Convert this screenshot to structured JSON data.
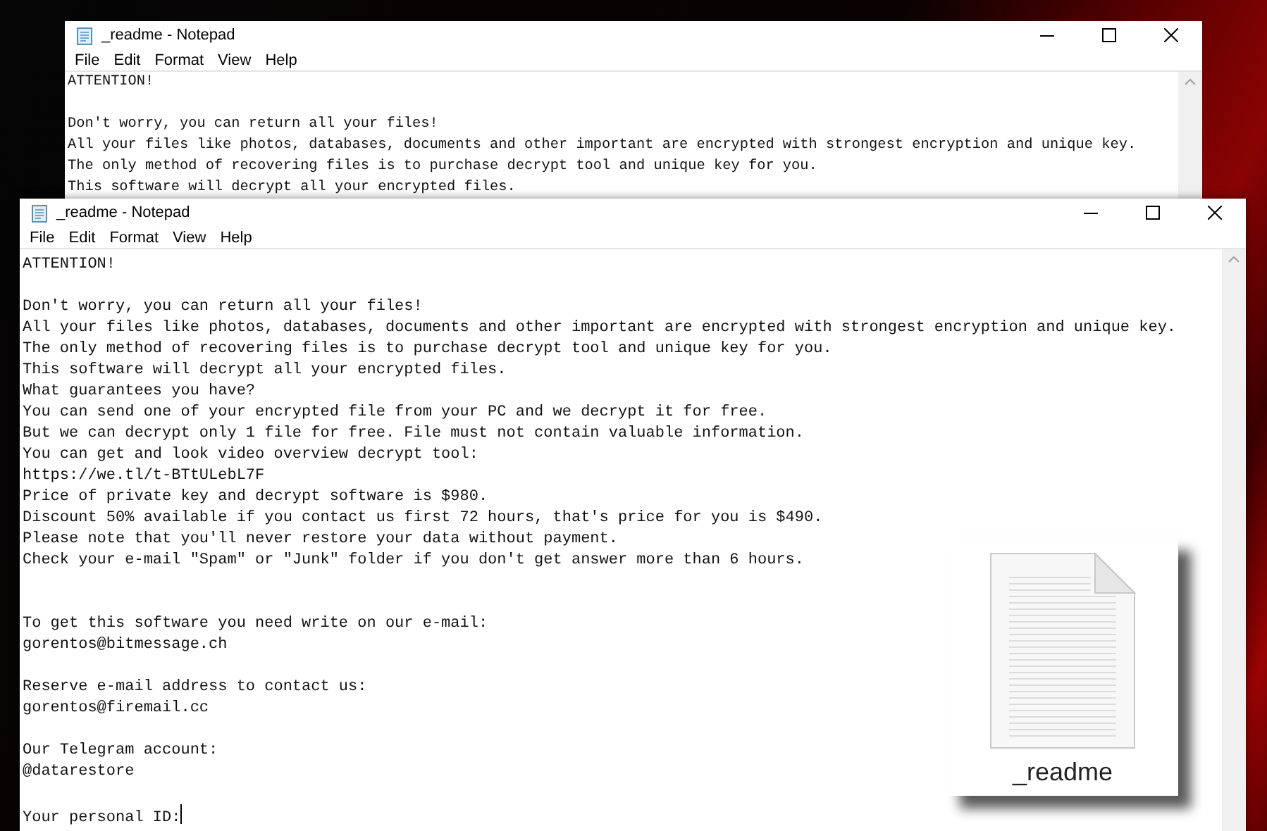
{
  "windows": [
    {
      "title": "_readme - Notepad",
      "active": false,
      "menu": [
        "File",
        "Edit",
        "Format",
        "View",
        "Help"
      ],
      "lines": [
        {
          "kind": "text",
          "text": "ATTENTION!"
        },
        {
          "kind": "blank"
        },
        {
          "kind": "text",
          "text": "Don't worry, you can return all your files!"
        },
        {
          "kind": "text",
          "text": "All your files like photos, databases, documents and other important are encrypted with strongest encryption and unique key."
        },
        {
          "kind": "text",
          "text": "The only method of recovering files is to purchase decrypt tool and unique key for you."
        },
        {
          "kind": "text",
          "text": "This software will decrypt all your encrypted files."
        }
      ]
    },
    {
      "title": "_readme - Notepad",
      "active": true,
      "menu": [
        "File",
        "Edit",
        "Format",
        "View",
        "Help"
      ],
      "lines": [
        {
          "kind": "text",
          "text": "ATTENTION!"
        },
        {
          "kind": "blank"
        },
        {
          "kind": "text",
          "text": "Don't worry, you can return all your files!"
        },
        {
          "kind": "text",
          "text": "All your files like photos, databases, documents and other important are encrypted with strongest encryption and unique key."
        },
        {
          "kind": "text",
          "text": "The only method of recovering files is to purchase decrypt tool and unique key for you."
        },
        {
          "kind": "text",
          "text": "This software will decrypt all your encrypted files."
        },
        {
          "kind": "text",
          "text": "What guarantees you have?"
        },
        {
          "kind": "text",
          "text": "You can send one of your encrypted file from your PC and we decrypt it for free."
        },
        {
          "kind": "text",
          "text": "But we can decrypt only 1 file for free. File must not contain valuable information."
        },
        {
          "kind": "text",
          "text": "You can get and look video overview decrypt tool:"
        },
        {
          "kind": "text",
          "text": "https://we.tl/t-BTtULebL7F"
        },
        {
          "kind": "text",
          "text": "Price of private key and decrypt software is $980."
        },
        {
          "kind": "text",
          "text": "Discount 50% available if you contact us first 72 hours, that's price for you is $490."
        },
        {
          "kind": "text",
          "text": "Please note that you'll never restore your data without payment."
        },
        {
          "kind": "text",
          "text": "Check your e-mail \"Spam\" or \"Junk\" folder if you don't get answer more than 6 hours."
        },
        {
          "kind": "blank"
        },
        {
          "kind": "blank"
        },
        {
          "kind": "text",
          "text": "To get this software you need write on our e-mail:"
        },
        {
          "kind": "text",
          "text": "gorentos@bitmessage.ch"
        },
        {
          "kind": "blank"
        },
        {
          "kind": "text",
          "text": "Reserve e-mail address to contact us:"
        },
        {
          "kind": "text",
          "text": "gorentos@firemail.cc"
        },
        {
          "kind": "blank"
        },
        {
          "kind": "text",
          "text": "Our Telegram account:"
        },
        {
          "kind": "text",
          "text": "@datarestore"
        },
        {
          "kind": "blank"
        },
        {
          "kind": "text",
          "text": "Your personal ID:"
        }
      ]
    }
  ],
  "file_icon": {
    "label": "_readme"
  }
}
